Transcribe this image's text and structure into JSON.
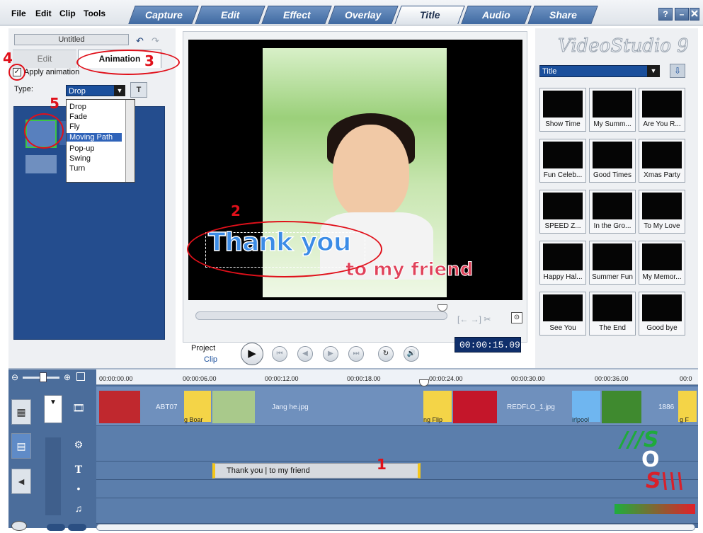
{
  "menu": {
    "file": "File",
    "edit": "Edit",
    "clip": "Clip",
    "tools": "Tools"
  },
  "steps": [
    "Capture",
    "Edit",
    "Effect",
    "Overlay",
    "Title",
    "Audio",
    "Share"
  ],
  "active_step": "Title",
  "window_buttons": {
    "help": "?",
    "minimize": "–"
  },
  "options": {
    "file_name": "Untitled",
    "tab_edit": "Edit",
    "tab_animation": "Animation",
    "apply_label": "Apply animation",
    "apply_check": "✓",
    "type_label": "Type:",
    "type_value": "Drop",
    "dropdown_options": [
      "Drop",
      "Fade",
      "Fly",
      "Moving Path",
      "Pop-up",
      "Swing",
      "Turn"
    ],
    "highlighted_option": "Moving Path"
  },
  "preview": {
    "title_text": "Thank you",
    "subtitle_text": "to my friend",
    "project_label": "Project",
    "clip_label": "Clip",
    "timecode": "00:00:15.09"
  },
  "library": {
    "logo": "VideoStudio 9",
    "category": "Title",
    "thumbnails": [
      "Show Time",
      "My Summ...",
      "Are You R...",
      "Fun Celeb...",
      "Good Times",
      "Xmas Party",
      "SPEED Z...",
      "In the Gro...",
      "To My Love",
      "Happy Hal...",
      "Summer Fun",
      "My Memor...",
      "See You",
      "The End",
      "Good bye"
    ]
  },
  "timeline": {
    "ticks": [
      "00:00:00.00",
      "00:00:06.00",
      "00:00:12.00",
      "00:00:18.00",
      "00:00:24.00",
      "00:00:30.00",
      "00:00:36.00",
      "00:0"
    ],
    "video_clips": [
      "ABT07",
      "Jang he.jpg",
      "REDFLO_1.jpg",
      "1886"
    ],
    "transition_labels": [
      "g Boar",
      "ng Flip",
      "irlpool",
      "g F"
    ],
    "title_clip": "Thank you | to my friend"
  },
  "annotations": [
    "1",
    "2",
    "3",
    "4",
    "5"
  ],
  "colors": {
    "accent_blue": "#1a4f9c",
    "annotation_red": "#e0101a",
    "title_blue": "#3c8ce6",
    "subtitle_red": "#e0425a"
  }
}
